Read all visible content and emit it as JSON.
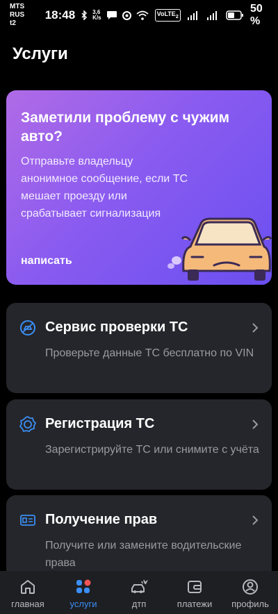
{
  "status_bar": {
    "carrier_line1": "MTS RUS",
    "carrier_line2": "t2",
    "time": "18:48",
    "net_speed_value": "3,6",
    "net_speed_unit": "K/s",
    "volte": "VoLTE",
    "volte_sub": "2",
    "battery_percent": "50 %",
    "icons": [
      "bluetooth-icon",
      "chat-icon",
      "sync-icon",
      "wifi-icon",
      "signal-icon",
      "signal-icon",
      "battery-icon"
    ]
  },
  "page": {
    "title": "Услуги"
  },
  "promo": {
    "title": "Заметили проблему с чужим авто?",
    "text": "Отправьте владельцу анонимное сообщение, если ТС мешает проезду или срабатывает сигнализация",
    "action": "написать"
  },
  "services": [
    {
      "title": "Сервис проверки ТС",
      "description": "Проверьте данные ТС бесплатно по VIN",
      "icon": "car-check-icon"
    },
    {
      "title": "Регистрация ТС",
      "description": "Зарегистрируйте ТС или снимите с учёта",
      "icon": "badge-icon"
    },
    {
      "title": "Получение прав",
      "description": "Получите или замените водительские права",
      "icon": "license-icon"
    }
  ],
  "tabs": [
    {
      "label": "главная",
      "icon": "home-icon"
    },
    {
      "label": "услуги",
      "icon": "services-icon",
      "active": true
    },
    {
      "label": "дтп",
      "icon": "accident-icon"
    },
    {
      "label": "платежи",
      "icon": "wallet-icon"
    },
    {
      "label": "профиль",
      "icon": "profile-icon"
    }
  ],
  "colors": {
    "accent": "#3b8ff5",
    "card_bg": "#25262b",
    "tab_bar_bg": "#1e1f23",
    "promo_gradient_start": "#b06be6",
    "promo_gradient_end": "#6a4ff0",
    "badge_red": "#f05454"
  }
}
